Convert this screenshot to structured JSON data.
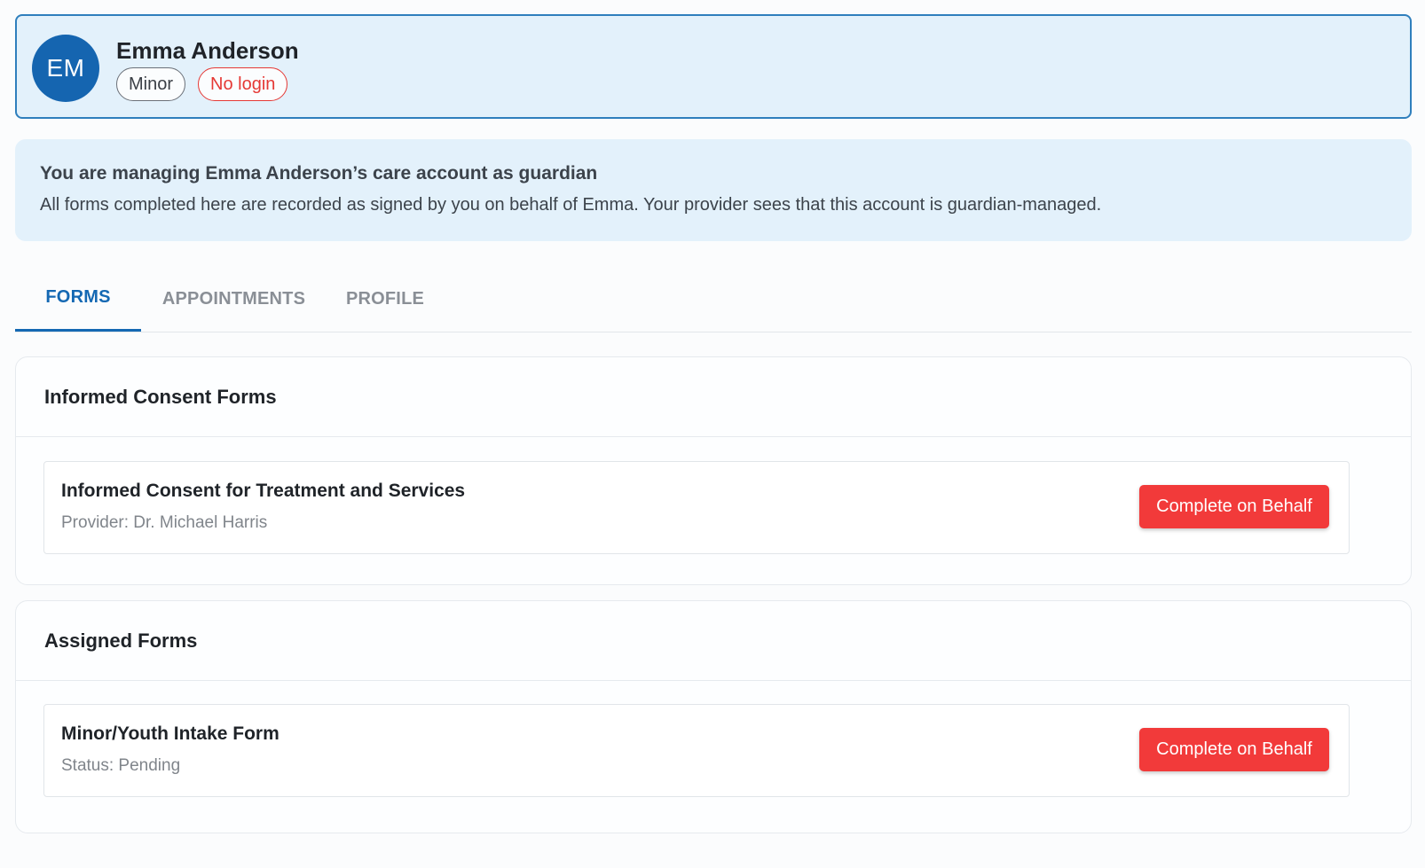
{
  "user": {
    "initials": "EM",
    "name": "Emma Anderson",
    "chips": {
      "minor": "Minor",
      "no_login": "No login"
    }
  },
  "notice": {
    "title": "You are managing Emma Anderson’s care account as guardian",
    "body": "All forms completed here are recorded as signed by you on behalf of Emma.  Your provider sees that this account is guardian-managed."
  },
  "tabs": [
    {
      "label": "FORMS",
      "active": true
    },
    {
      "label": "APPOINTMENTS",
      "active": false
    },
    {
      "label": "PROFILE",
      "active": false
    }
  ],
  "sections": {
    "consent": {
      "title": "Informed Consent Forms",
      "items": [
        {
          "title": "Informed Consent for Treatment and Services",
          "meta": "Provider: Dr. Michael Harris",
          "action": "Complete on Behalf"
        }
      ]
    },
    "assigned": {
      "title": "Assigned Forms",
      "items": [
        {
          "title": "Minor/Youth Intake Form",
          "meta": "Status: Pending",
          "action": "Complete on Behalf"
        }
      ]
    }
  },
  "colors": {
    "accent": "#1468b3",
    "avatar": "#1565b0",
    "danger": "#f23a3a",
    "info_bg": "#e3f1fb"
  }
}
